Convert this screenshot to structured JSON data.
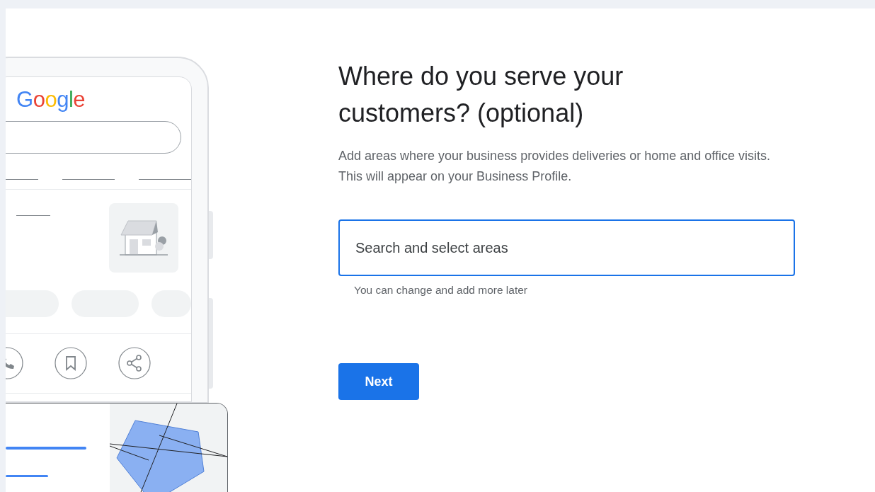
{
  "illustration": {
    "logo": "Google"
  },
  "heading": "Where do you serve your customers? (optional)",
  "description": "Add areas where your business provides deliveries or home and office visits. This will appear on your Business Profile.",
  "field": {
    "placeholder": "Search and select areas",
    "focused": true,
    "helper": "You can change and add more later"
  },
  "button": "Next"
}
